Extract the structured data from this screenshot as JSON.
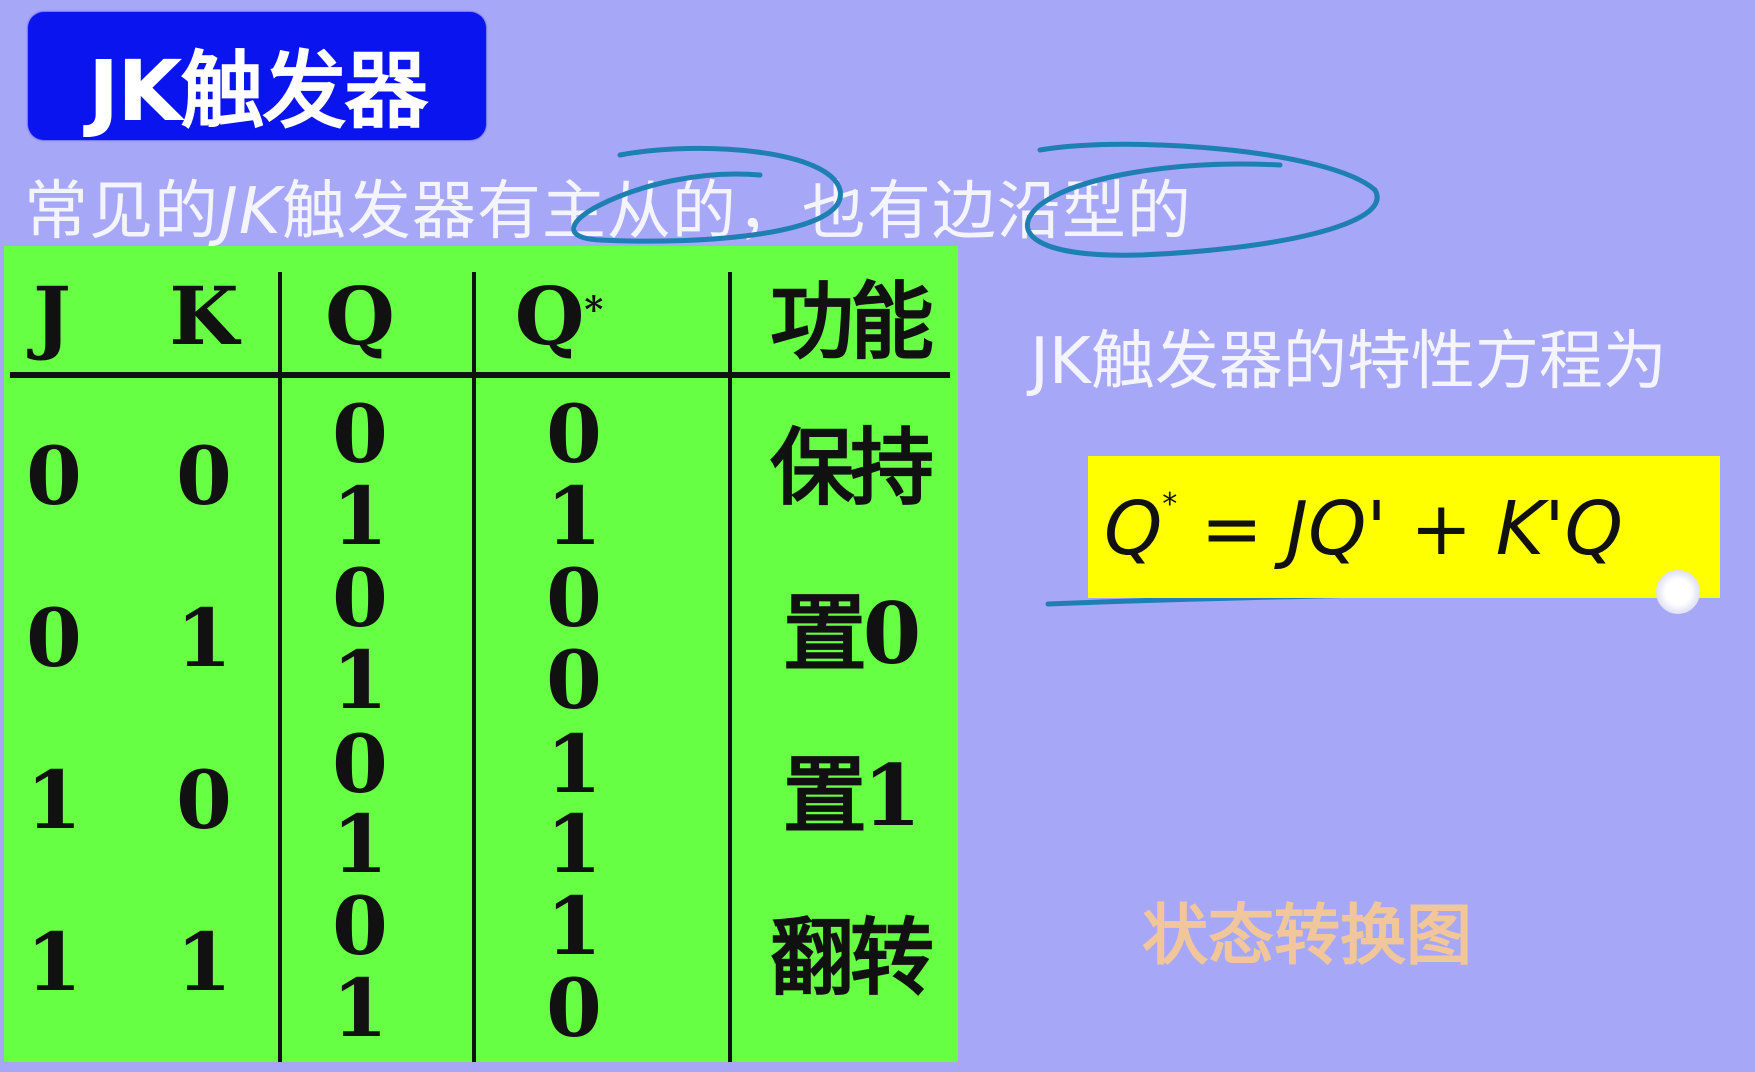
{
  "slide": {
    "title": "JK触发器",
    "subtitle_parts": [
      "常见的",
      "JK",
      "触发器有主从的，也有边沿型的"
    ]
  },
  "truth_table": {
    "headers": [
      "J",
      "K",
      "Q",
      "Q",
      "功能"
    ],
    "q_next_superscript": "*",
    "rows": [
      {
        "J": "0",
        "K": "0",
        "Q": [
          "0",
          "1"
        ],
        "Qn": [
          "0",
          "1"
        ],
        "function": "保持"
      },
      {
        "J": "0",
        "K": "1",
        "Q": [
          "0",
          "1"
        ],
        "Qn": [
          "0",
          "0"
        ],
        "function": "置0"
      },
      {
        "J": "1",
        "K": "0",
        "Q": [
          "0",
          "1"
        ],
        "Qn": [
          "1",
          "1"
        ],
        "function": "置1"
      },
      {
        "J": "1",
        "K": "1",
        "Q": [
          "0",
          "1"
        ],
        "Qn": [
          "1",
          "0"
        ],
        "function": "翻转"
      }
    ]
  },
  "characteristic": {
    "title": "JK触发器的特性方程为",
    "formula_lhs": "Q",
    "formula_sup": "*",
    "formula_rhs": "= JQ' + K'Q"
  },
  "state_diagram_link": "状态转换图",
  "colors": {
    "background": "#a7a7f7",
    "title_box": "#0a14ee",
    "table_bg": "#66ff44",
    "formula_bg": "#ffff00",
    "annotation_ink": "#1e7fb3",
    "link_text": "#f2c69b"
  }
}
